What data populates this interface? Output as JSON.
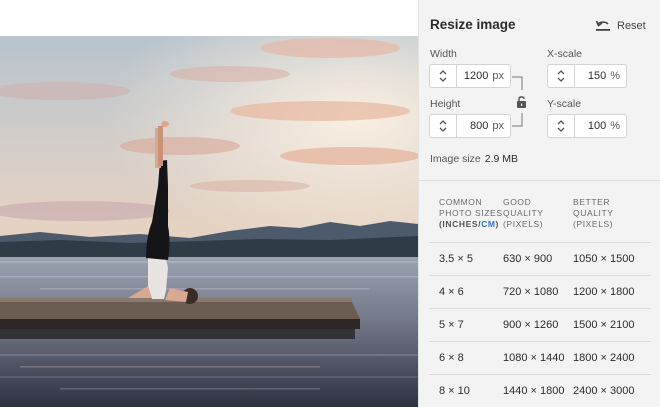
{
  "panel": {
    "title": "Resize image",
    "reset_label": "Reset",
    "width": {
      "label": "Width",
      "value": "1200",
      "unit": "px"
    },
    "height": {
      "label": "Height",
      "value": "800",
      "unit": "px"
    },
    "xscale": {
      "label": "X-scale",
      "value": "150",
      "unit": "%"
    },
    "yscale": {
      "label": "Y-scale",
      "value": "100",
      "unit": "%"
    },
    "image_size": {
      "label": "Image size",
      "value": "2.9 MB"
    }
  },
  "table": {
    "headers": {
      "common_line1": "COMMON",
      "common_line2": "PHOTO SIZES",
      "common_line3_open": "(INCHES/",
      "common_line3_cm": "CM",
      "common_line3_close": ")",
      "good_line1": "GOOD",
      "good_line2": "QUALITY",
      "good_line3": "(PIXELS)",
      "better_line1": "BETTER",
      "better_line2": "QUALITY",
      "better_line3": "(PIXELS)"
    },
    "rows": [
      {
        "size": "3.5 × 5",
        "good": "630 × 900",
        "better": "1050 × 1500"
      },
      {
        "size": "4 × 6",
        "good": "720 × 1080",
        "better": "1200 × 1800"
      },
      {
        "size": "5 × 7",
        "good": "900 × 1260",
        "better": "1500 × 2100"
      },
      {
        "size": "6 × 8",
        "good": "1080 × 1440",
        "better": "1800 × 2400"
      },
      {
        "size": "8 × 10",
        "good": "1440 × 1800",
        "better": "2400 × 3000"
      }
    ]
  },
  "icons": {
    "reset": "reset-undo-icon",
    "stepper": "up-down-chevron-icon",
    "lock": "unlocked-padlock-icon"
  },
  "colors": {
    "accent": "#2f74d0",
    "panel_bg": "#f3f3f3"
  }
}
